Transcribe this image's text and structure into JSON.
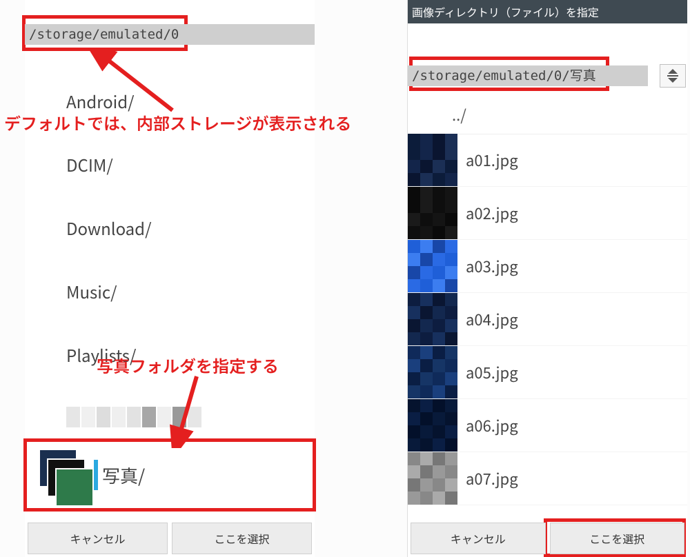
{
  "left": {
    "path": "/storage/emulated/0",
    "dirs": [
      "Android/",
      "DCIM/",
      "Download/",
      "Music/",
      "Playlists/"
    ],
    "photos_label": "写真/",
    "cancel": "キャンセル",
    "select": "ここを選択"
  },
  "right": {
    "appbar": "画像ディレクトリ（ファイル）を指定",
    "path": "/storage/emulated/0/写真",
    "updir": "../",
    "files": [
      "a01.jpg",
      "a02.jpg",
      "a03.jpg",
      "a04.jpg",
      "a05.jpg",
      "a06.jpg",
      "a07.jpg"
    ],
    "cancel": "キャンセル",
    "select": "ここを選択"
  },
  "annotations": {
    "default_storage": "デフォルトでは、内部ストレージが表示される",
    "choose_photos": "写真フォルダを指定する"
  },
  "thumb_palettes": [
    [
      "#0c1c3a",
      "#13254a",
      "#0a1530",
      "#1b2f55",
      "#0c1c3a",
      "#13254a",
      "#0a1530",
      "#1b2f55",
      "#13254a",
      "#0a1530",
      "#1b2f55",
      "#0c1c3a",
      "#0a1530",
      "#1b2f55",
      "#0c1c3a",
      "#13254a"
    ],
    [
      "#0a0a0a",
      "#1a1a1a",
      "#0e0e0e",
      "#141414",
      "#0a0a0a",
      "#1a1a1a",
      "#0e0e0e",
      "#141414",
      "#1a1a1a",
      "#0e0e0e",
      "#141414",
      "#0a0a0a",
      "#0e0e0e",
      "#141414",
      "#0a0a0a",
      "#1a1a1a"
    ],
    [
      "#1f5fd8",
      "#3c7df0",
      "#1847a8",
      "#2a6ae4",
      "#3c7df0",
      "#1847a8",
      "#2a6ae4",
      "#1f5fd8",
      "#1847a8",
      "#2a6ae4",
      "#1f5fd8",
      "#3c7df0",
      "#2a6ae4",
      "#1f5fd8",
      "#3c7df0",
      "#1847a8"
    ],
    [
      "#0d1d40",
      "#17305e",
      "#0a1632",
      "#13284f",
      "#17305e",
      "#0a1632",
      "#13284f",
      "#0d1d40",
      "#0a1632",
      "#13284f",
      "#0d1d40",
      "#17305e",
      "#13284f",
      "#0d1d40",
      "#17305e",
      "#0a1632"
    ],
    [
      "#0f2a5a",
      "#1a3f7d",
      "#0a1e44",
      "#163566",
      "#1a3f7d",
      "#0a1e44",
      "#163566",
      "#0f2a5a",
      "#0a1e44",
      "#163566",
      "#0f2a5a",
      "#1a3f7d",
      "#163566",
      "#0f2a5a",
      "#1a3f7d",
      "#0a1e44"
    ],
    [
      "#05132e",
      "#0a1e44",
      "#03102a",
      "#081a3a",
      "#0a1e44",
      "#03102a",
      "#081a3a",
      "#05132e",
      "#03102a",
      "#081a3a",
      "#05132e",
      "#0a1e44",
      "#081a3a",
      "#05132e",
      "#0a1e44",
      "#03102a"
    ],
    [
      "#888",
      "#aaa",
      "#777",
      "#999",
      "#aaa",
      "#777",
      "#999",
      "#888",
      "#777",
      "#999",
      "#888",
      "#aaa",
      "#999",
      "#888",
      "#aaa",
      "#777"
    ]
  ]
}
